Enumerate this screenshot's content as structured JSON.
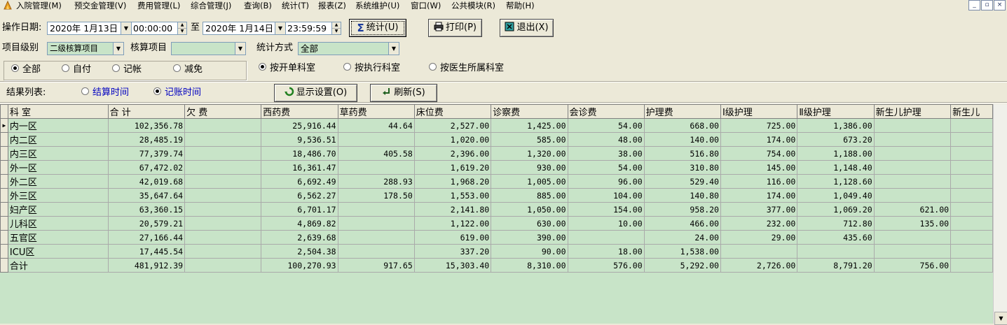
{
  "menu": [
    "入院管理(M)",
    "预交金管理(V)",
    "费用管理(L)",
    "综合管理(J)",
    "查询(B)",
    "统计(T)",
    "报表(Z)",
    "系统维护(U)",
    "窗口(W)",
    "公共模块(R)",
    "帮助(H)"
  ],
  "window_buttons": {
    "minimize": "_",
    "restore": "▫",
    "close": "×"
  },
  "filters": {
    "date_label": "操作日期:",
    "start_date": "2020年 1月13日",
    "start_time": "00:00:00",
    "to_label": "至",
    "end_date": "2020年 1月14日",
    "end_time": "23:59:59",
    "level_label": "项目级别",
    "level_value": "二级核算项目",
    "item_label": "核算项目",
    "item_value": "",
    "method_label": "统计方式",
    "method_value": "全部"
  },
  "buttons": {
    "stat": "统计(U)",
    "print": "打印(P)",
    "exit": "退出(X)",
    "display": "显示设置(O)",
    "refresh": "刷新(S)"
  },
  "type_radios": [
    "全部",
    "自付",
    "记帐",
    "减免"
  ],
  "dept_radios": [
    "按开单科室",
    "按执行科室",
    "按医生所属科室"
  ],
  "result_label": "结果列表:",
  "time_radios": [
    "结算时间",
    "记账时间"
  ],
  "table": {
    "headers": [
      "科  室",
      "合 计",
      "欠 费",
      "西药费",
      "草药费",
      "床位费",
      "诊察费",
      "会诊费",
      "护理费",
      "Ⅰ级护理",
      "Ⅱ级护理",
      "新生儿护理",
      "新生儿"
    ],
    "rows": [
      [
        "内一区",
        "102,356.78",
        "",
        "25,916.44",
        "44.64",
        "2,527.00",
        "1,425.00",
        "54.00",
        "668.00",
        "725.00",
        "1,386.00",
        "",
        ""
      ],
      [
        "内二区",
        "28,485.19",
        "",
        "9,536.51",
        "",
        "1,020.00",
        "585.00",
        "48.00",
        "140.00",
        "174.00",
        "673.20",
        "",
        ""
      ],
      [
        "内三区",
        "77,379.74",
        "",
        "18,486.70",
        "405.58",
        "2,396.00",
        "1,320.00",
        "38.00",
        "516.80",
        "754.00",
        "1,188.00",
        "",
        ""
      ],
      [
        "外一区",
        "67,472.02",
        "",
        "16,361.47",
        "",
        "1,619.20",
        "930.00",
        "54.00",
        "310.80",
        "145.00",
        "1,148.40",
        "",
        ""
      ],
      [
        "外二区",
        "42,019.68",
        "",
        "6,692.49",
        "288.93",
        "1,968.20",
        "1,005.00",
        "96.00",
        "529.40",
        "116.00",
        "1,128.60",
        "",
        ""
      ],
      [
        "外三区",
        "35,647.64",
        "",
        "6,562.27",
        "178.50",
        "1,553.00",
        "885.00",
        "104.00",
        "140.80",
        "174.00",
        "1,049.40",
        "",
        ""
      ],
      [
        "妇产区",
        "63,360.15",
        "",
        "6,701.17",
        "",
        "2,141.80",
        "1,050.00",
        "154.00",
        "958.20",
        "377.00",
        "1,069.20",
        "621.00",
        ""
      ],
      [
        "儿科区",
        "20,579.21",
        "",
        "4,869.82",
        "",
        "1,122.00",
        "630.00",
        "10.00",
        "466.00",
        "232.00",
        "712.80",
        "135.00",
        ""
      ],
      [
        "五官区",
        "27,166.44",
        "",
        "2,639.68",
        "",
        "619.00",
        "390.00",
        "",
        "24.00",
        "29.00",
        "435.60",
        "",
        ""
      ],
      [
        "ICU区",
        "17,445.54",
        "",
        "2,504.38",
        "",
        "337.20",
        "90.00",
        "18.00",
        "1,538.00",
        "",
        "",
        "",
        ""
      ],
      [
        "合计",
        "481,912.39",
        "",
        "100,270.93",
        "917.65",
        "15,303.40",
        "8,310.00",
        "576.00",
        "5,292.00",
        "2,726.00",
        "8,791.20",
        "756.00",
        ""
      ]
    ]
  }
}
